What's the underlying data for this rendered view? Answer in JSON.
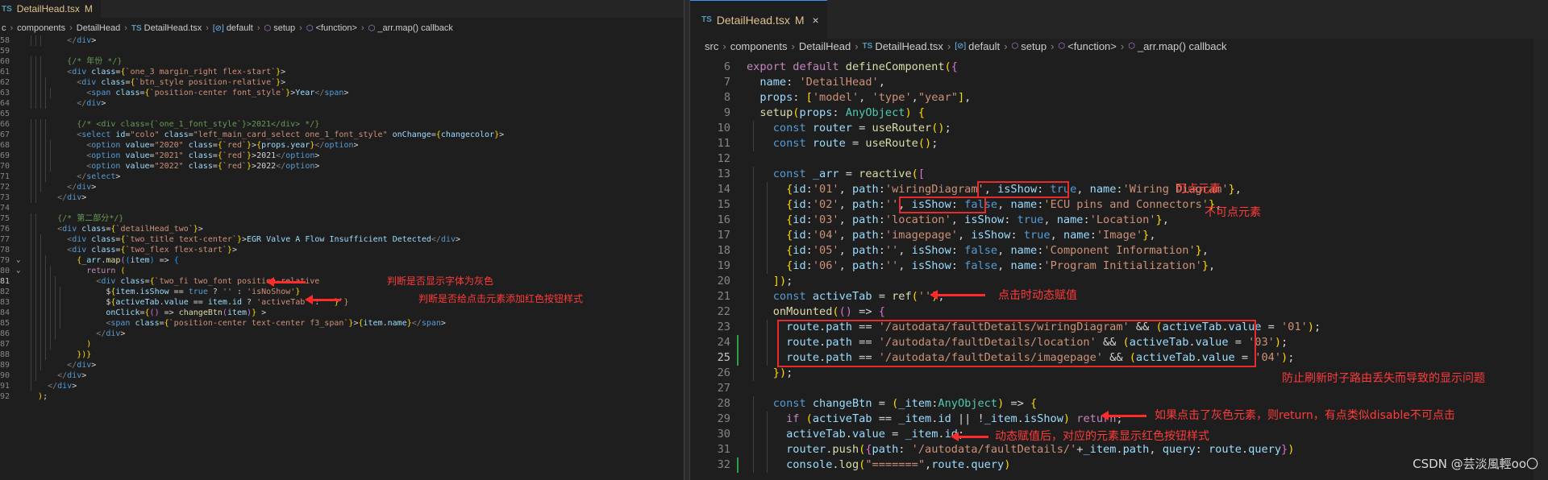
{
  "left": {
    "tab": {
      "icon": "TS",
      "label": "DetailHead.tsx",
      "status": "M"
    },
    "breadcrumb": [
      "c",
      "components",
      "DetailHead",
      "DetailHead.tsx",
      "default",
      "setup",
      "<function>",
      "_arr.map() callback"
    ],
    "lines": [
      {
        "n": "58",
        "code": "        </div>"
      },
      {
        "n": "59",
        "code": ""
      },
      {
        "n": "60",
        "code": "        {/* 年份 */}"
      },
      {
        "n": "61",
        "code": "        <div class={`one_3 margin_right flex-start`}>"
      },
      {
        "n": "62",
        "code": "          <div class={`btn_style position-relative`}>"
      },
      {
        "n": "63",
        "code": "            <span class={`position-center font_style`}>Year</span>"
      },
      {
        "n": "64",
        "code": "          </div>"
      },
      {
        "n": "65",
        "code": ""
      },
      {
        "n": "66",
        "code": "          {/* <div class={`one_1_font_style`}>2021</div> */}"
      },
      {
        "n": "67",
        "code": "          <select id=\"colo\" class=\"left_main_card_select one_1_font_style\" onChange={changecolor}>"
      },
      {
        "n": "68",
        "code": "            <option value=\"2020\" class={`red`}>{props.year}</option>"
      },
      {
        "n": "69",
        "code": "            <option value=\"2021\" class={`red`}>2021</option>"
      },
      {
        "n": "70",
        "code": "            <option value=\"2022\" class={`red`}>2022</option>"
      },
      {
        "n": "71",
        "code": "          </select>"
      },
      {
        "n": "72",
        "code": "        </div>"
      },
      {
        "n": "73",
        "code": "      </div>"
      },
      {
        "n": "74",
        "code": ""
      },
      {
        "n": "75",
        "code": "      {/* 第二部分*/}"
      },
      {
        "n": "76",
        "code": "      <div class={`detailHead_two`}>"
      },
      {
        "n": "77",
        "code": "        <div class={`two_title text-center`}>EGR Valve A Flow Insufficient Detected</div>"
      },
      {
        "n": "78",
        "code": "        <div class={`two_flex flex-start`}>"
      },
      {
        "n": "79",
        "code": "          {_arr.map((item) => {"
      },
      {
        "n": "80",
        "code": "            return ("
      },
      {
        "n": "81",
        "code": "              <div class={`two_fi two_font position-relative"
      },
      {
        "n": "82",
        "code": "                ${item.isShow == true ? '' : 'isNoShow'}"
      },
      {
        "n": "83",
        "code": "                ${activeTab.value == item.id ? 'activeTab' : ''}`}"
      },
      {
        "n": "84",
        "code": "                onClick={() => changeBtn(item)} >"
      },
      {
        "n": "85",
        "code": "                <span class={`position-center text-center f3_span`}>{item.name}</span>"
      },
      {
        "n": "86",
        "code": "              </div>"
      },
      {
        "n": "87",
        "code": "            )"
      },
      {
        "n": "88",
        "code": "          })}"
      },
      {
        "n": "89",
        "code": "        </div>"
      },
      {
        "n": "90",
        "code": "      </div>"
      },
      {
        "n": "91",
        "code": "    </div>"
      },
      {
        "n": "92",
        "code": "  );"
      }
    ],
    "annotations": {
      "gray_font": "判断是否显示字体为灰色",
      "red_button": "判断是否给点击元素添加红色按钮样式"
    }
  },
  "right": {
    "tab": {
      "icon": "TS",
      "label": "DetailHead.tsx",
      "status": "M",
      "close": "×"
    },
    "breadcrumb": [
      "src",
      "components",
      "DetailHead",
      "DetailHead.tsx",
      "default",
      "setup",
      "<function>",
      "_arr.map() callback"
    ],
    "lines": [
      {
        "n": "6",
        "code": "export default defineComponent({"
      },
      {
        "n": "7",
        "code": "  name: 'DetailHead',"
      },
      {
        "n": "8",
        "code": "  props: ['model', 'type',\"year\"],"
      },
      {
        "n": "9",
        "code": "  setup(props: AnyObject) {"
      },
      {
        "n": "10",
        "code": "    const router = useRouter();"
      },
      {
        "n": "11",
        "code": "    const route = useRoute();"
      },
      {
        "n": "12",
        "code": ""
      },
      {
        "n": "13",
        "code": "    const _arr = reactive(["
      },
      {
        "n": "14",
        "code": "      {id:'01', path:'wiringDiagram', isShow: true, name:'Wiring Diagram'},"
      },
      {
        "n": "15",
        "code": "      {id:'02', path:'', isShow: false, name:'ECU pins and Connectors'},"
      },
      {
        "n": "16",
        "code": "      {id:'03', path:'location', isShow: true, name:'Location'},"
      },
      {
        "n": "17",
        "code": "      {id:'04', path:'imagepage', isShow: true, name:'Image'},"
      },
      {
        "n": "18",
        "code": "      {id:'05', path:'', isShow: false, name:'Component Information'},"
      },
      {
        "n": "19",
        "code": "      {id:'06', path:'', isShow: false, name:'Program Initialization'},"
      },
      {
        "n": "20",
        "code": "    ]);"
      },
      {
        "n": "21",
        "code": "    const activeTab = ref('');"
      },
      {
        "n": "22",
        "code": "    onMounted(() => {"
      },
      {
        "n": "23",
        "code": "      route.path == '/autodata/faultDetails/wiringDiagram' && (activeTab.value = '01');"
      },
      {
        "n": "24",
        "code": "      route.path == '/autodata/faultDetails/location' && (activeTab.value = '03');"
      },
      {
        "n": "25",
        "code": "      route.path == '/autodata/faultDetails/imagepage' && (activeTab.value = '04');"
      },
      {
        "n": "26",
        "code": "    });"
      },
      {
        "n": "27",
        "code": ""
      },
      {
        "n": "28",
        "code": "    const changeBtn = (_item:AnyObject) => {"
      },
      {
        "n": "29",
        "code": "      if (activeTab == _item.id || !_item.isShow) return;"
      },
      {
        "n": "30",
        "code": "      activeTab.value = _item.id;"
      },
      {
        "n": "31",
        "code": "      router.push({path: '/autodata/faultDetails/'+_item.path, query: route.query})"
      },
      {
        "n": "32",
        "code": "      console.log(\"=======\",route.query)"
      }
    ],
    "annotations": {
      "clickable": "可点元素",
      "not_clickable": "不可点元素",
      "dynamic_assign": "点击时动态赋值",
      "refresh_note": "防止刷新时子路由丢失而导致的显示问题",
      "gray_return": "如果点击了灰色元素，则return，有点类似disable不可点击",
      "after_assign": "动态赋值后，对应的元素显示红色按钮样式"
    },
    "watermark": "CSDN @芸淡風輕oo〇"
  },
  "colors": {
    "background": "#1e1e1e",
    "annotation_red": "#ff3b3b",
    "tab_modified": "#e2c08d"
  }
}
